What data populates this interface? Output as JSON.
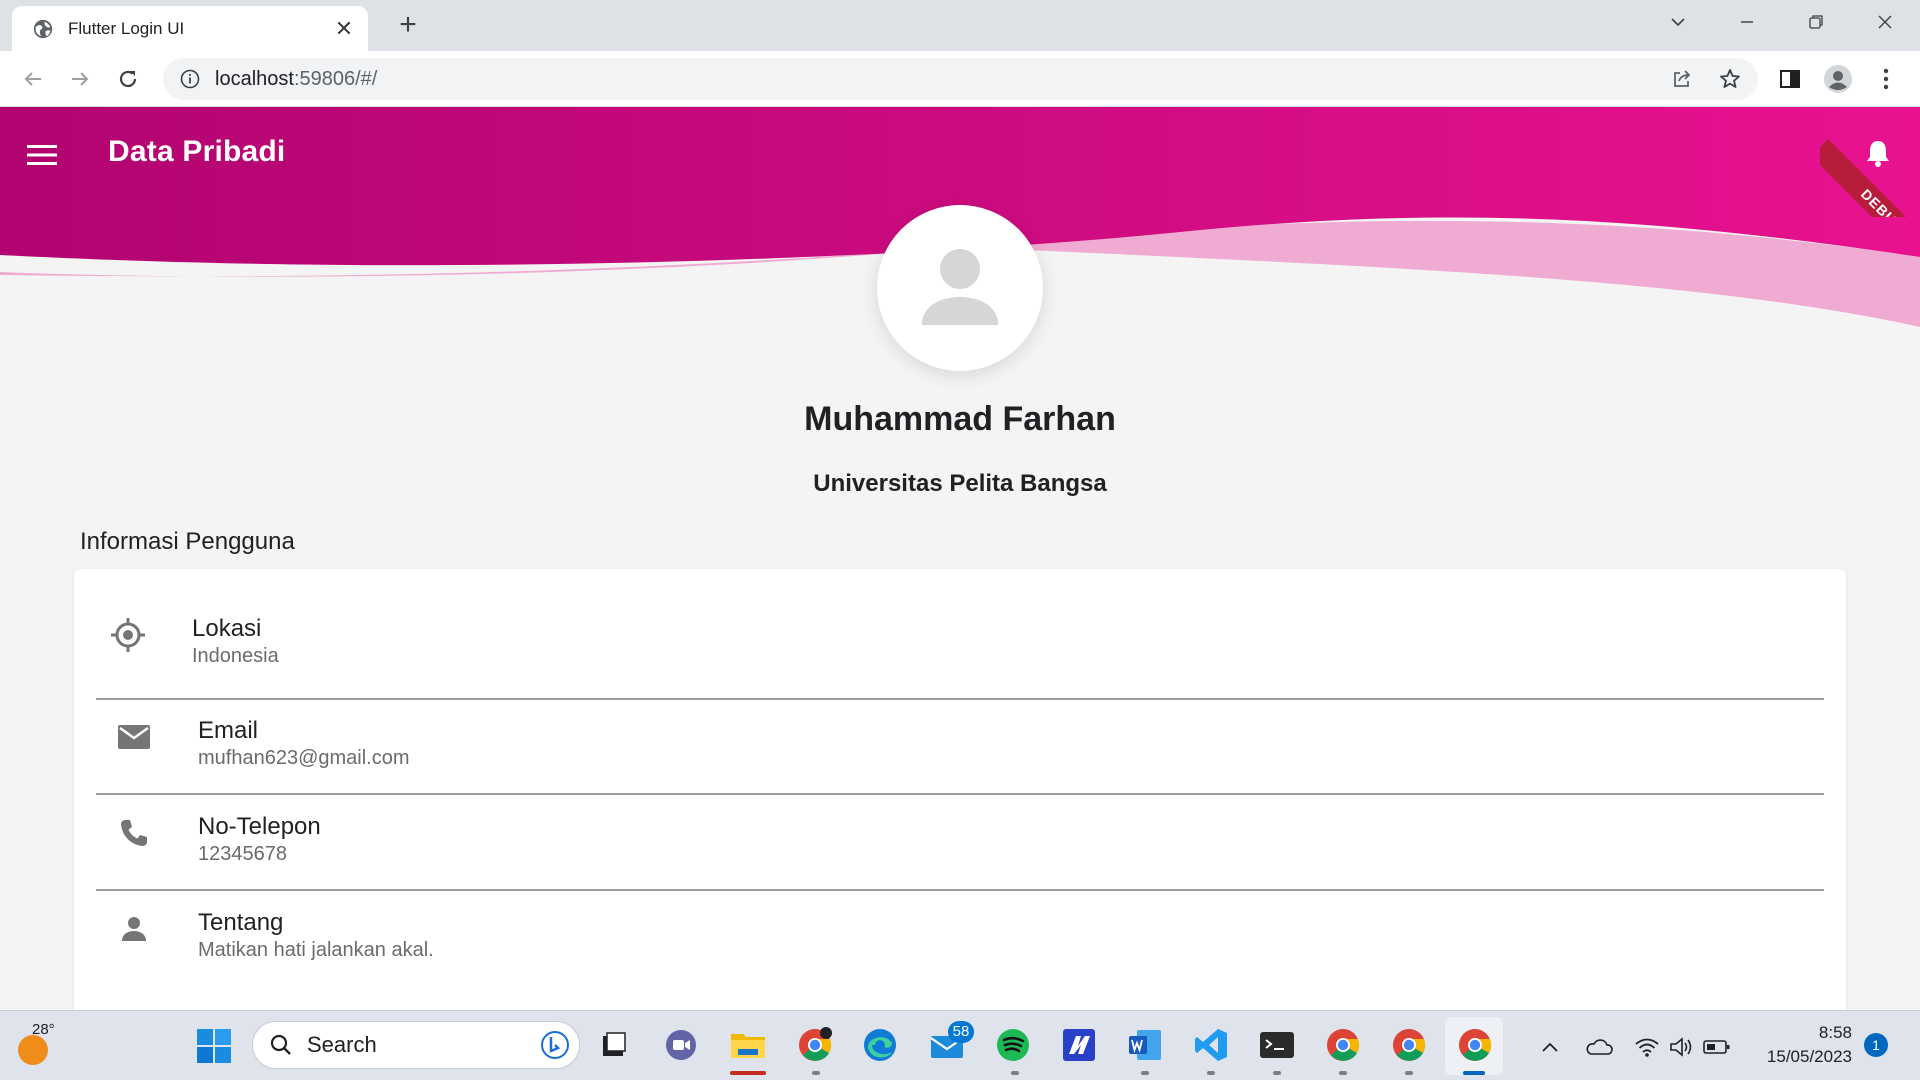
{
  "browser": {
    "tab_title": "Flutter Login UI",
    "url_host": "localhost",
    "url_rest": ":59806/#/"
  },
  "app": {
    "title": "Data Pribadi",
    "debug_label": "DEBUG",
    "colors": {
      "header_start": "#b10470",
      "header_end": "#e8128f",
      "wave_light": "#eea6cf"
    },
    "profile": {
      "name": "Muhammad Farhan",
      "organization": "Universitas Pelita Bangsa"
    },
    "section_title": "Informasi Pengguna",
    "info_items": [
      {
        "icon": "location-target-icon",
        "label": "Lokasi",
        "value": "Indonesia"
      },
      {
        "icon": "email-icon",
        "label": "Email",
        "value": "mufhan623@gmail.com"
      },
      {
        "icon": "phone-icon",
        "label": "No-Telepon",
        "value": "12345678"
      },
      {
        "icon": "person-icon",
        "label": "Tentang",
        "value": "Matikan hati jalankan akal."
      }
    ]
  },
  "taskbar": {
    "weather_temp": "28°",
    "search_label": "Search",
    "mail_badge": "58",
    "time": "8:58",
    "date": "15/05/2023",
    "notification_count": "1"
  }
}
